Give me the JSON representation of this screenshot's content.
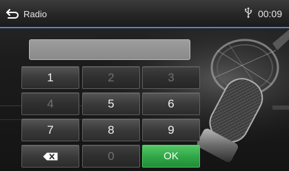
{
  "header": {
    "back_icon": "back-arrow-icon",
    "title": "Radio",
    "usb_icon": "usb-icon",
    "clock": "00:09"
  },
  "display": {
    "value": ""
  },
  "keypad": {
    "keys": [
      {
        "label": "1",
        "enabled": true
      },
      {
        "label": "2",
        "enabled": false
      },
      {
        "label": "3",
        "enabled": false
      },
      {
        "label": "4",
        "enabled": false
      },
      {
        "label": "5",
        "enabled": true
      },
      {
        "label": "6",
        "enabled": true
      },
      {
        "label": "7",
        "enabled": true
      },
      {
        "label": "8",
        "enabled": true
      },
      {
        "label": "9",
        "enabled": true
      },
      {
        "label": "",
        "icon": "backspace-icon",
        "enabled": true
      },
      {
        "label": "0",
        "enabled": false
      },
      {
        "label": "OK",
        "enabled": true
      }
    ]
  },
  "colors": {
    "accent_line": "#5a82c4",
    "ok_green": "#2fa546",
    "disabled_text": "#707070"
  }
}
